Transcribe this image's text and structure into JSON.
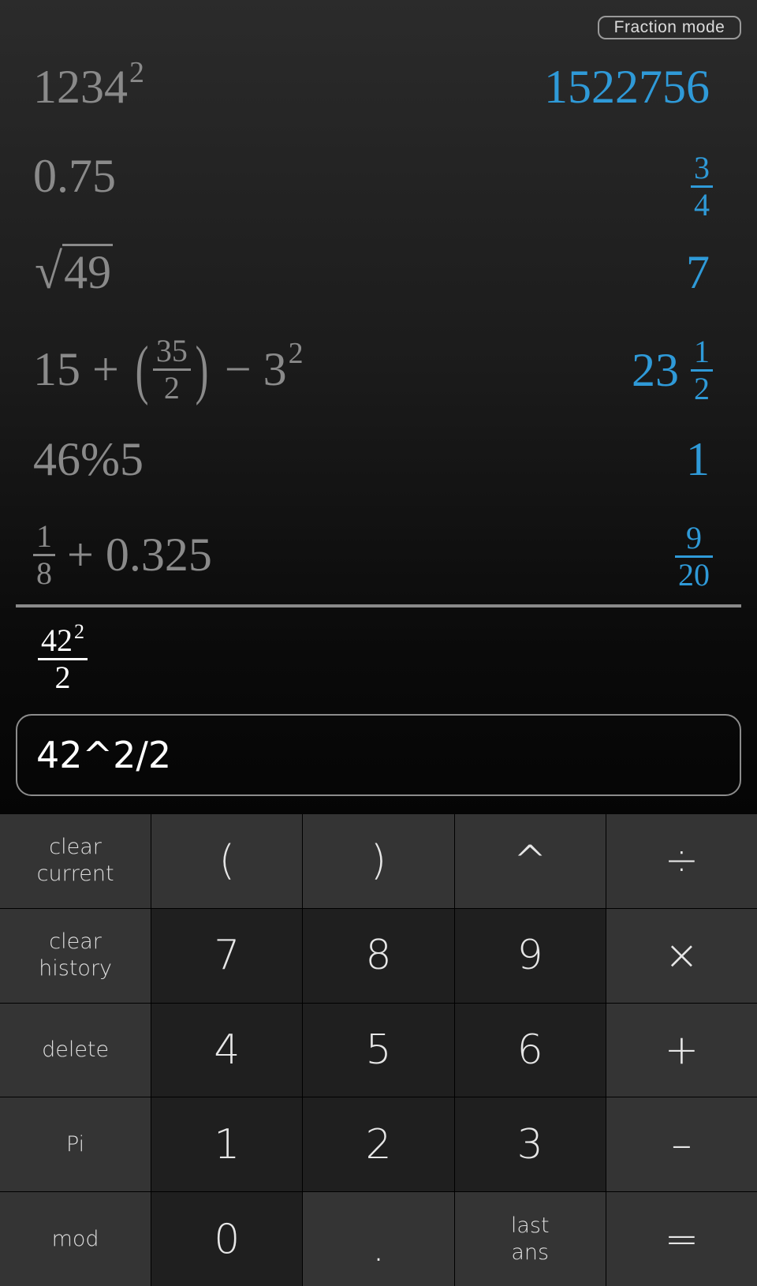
{
  "header": {
    "mode_button": "Fraction mode"
  },
  "history": [
    {
      "expr_base": "1234",
      "expr_exp": "2",
      "result": "1522756"
    },
    {
      "expr": "0.75",
      "result_num": "3",
      "result_den": "4"
    },
    {
      "expr_radicand": "49",
      "result": "7"
    },
    {
      "expr_a": "15 + ",
      "expr_frac_num": "35",
      "expr_frac_den": "2",
      "expr_b": " − 3",
      "expr_exp": "2",
      "result_whole": "23",
      "result_num": "1",
      "result_den": "2"
    },
    {
      "expr": "46%5",
      "result": "1"
    },
    {
      "expr_frac_num": "1",
      "expr_frac_den": "8",
      "expr_rest": " + 0.325",
      "result_num": "9",
      "result_den": "20"
    }
  ],
  "preview": {
    "num_base": "42",
    "num_exp": "2",
    "den": "2"
  },
  "input": {
    "value": "42^2/2"
  },
  "keypad": [
    [
      "clear\ncurrent",
      "(",
      ")",
      "^",
      "÷"
    ],
    [
      "clear\nhistory",
      "7",
      "8",
      "9",
      "×"
    ],
    [
      "delete",
      "4",
      "5",
      "6",
      "+"
    ],
    [
      "Pi",
      "1",
      "2",
      "3",
      "–"
    ],
    [
      "mod",
      "0",
      ".",
      "last\nans",
      "="
    ]
  ]
}
